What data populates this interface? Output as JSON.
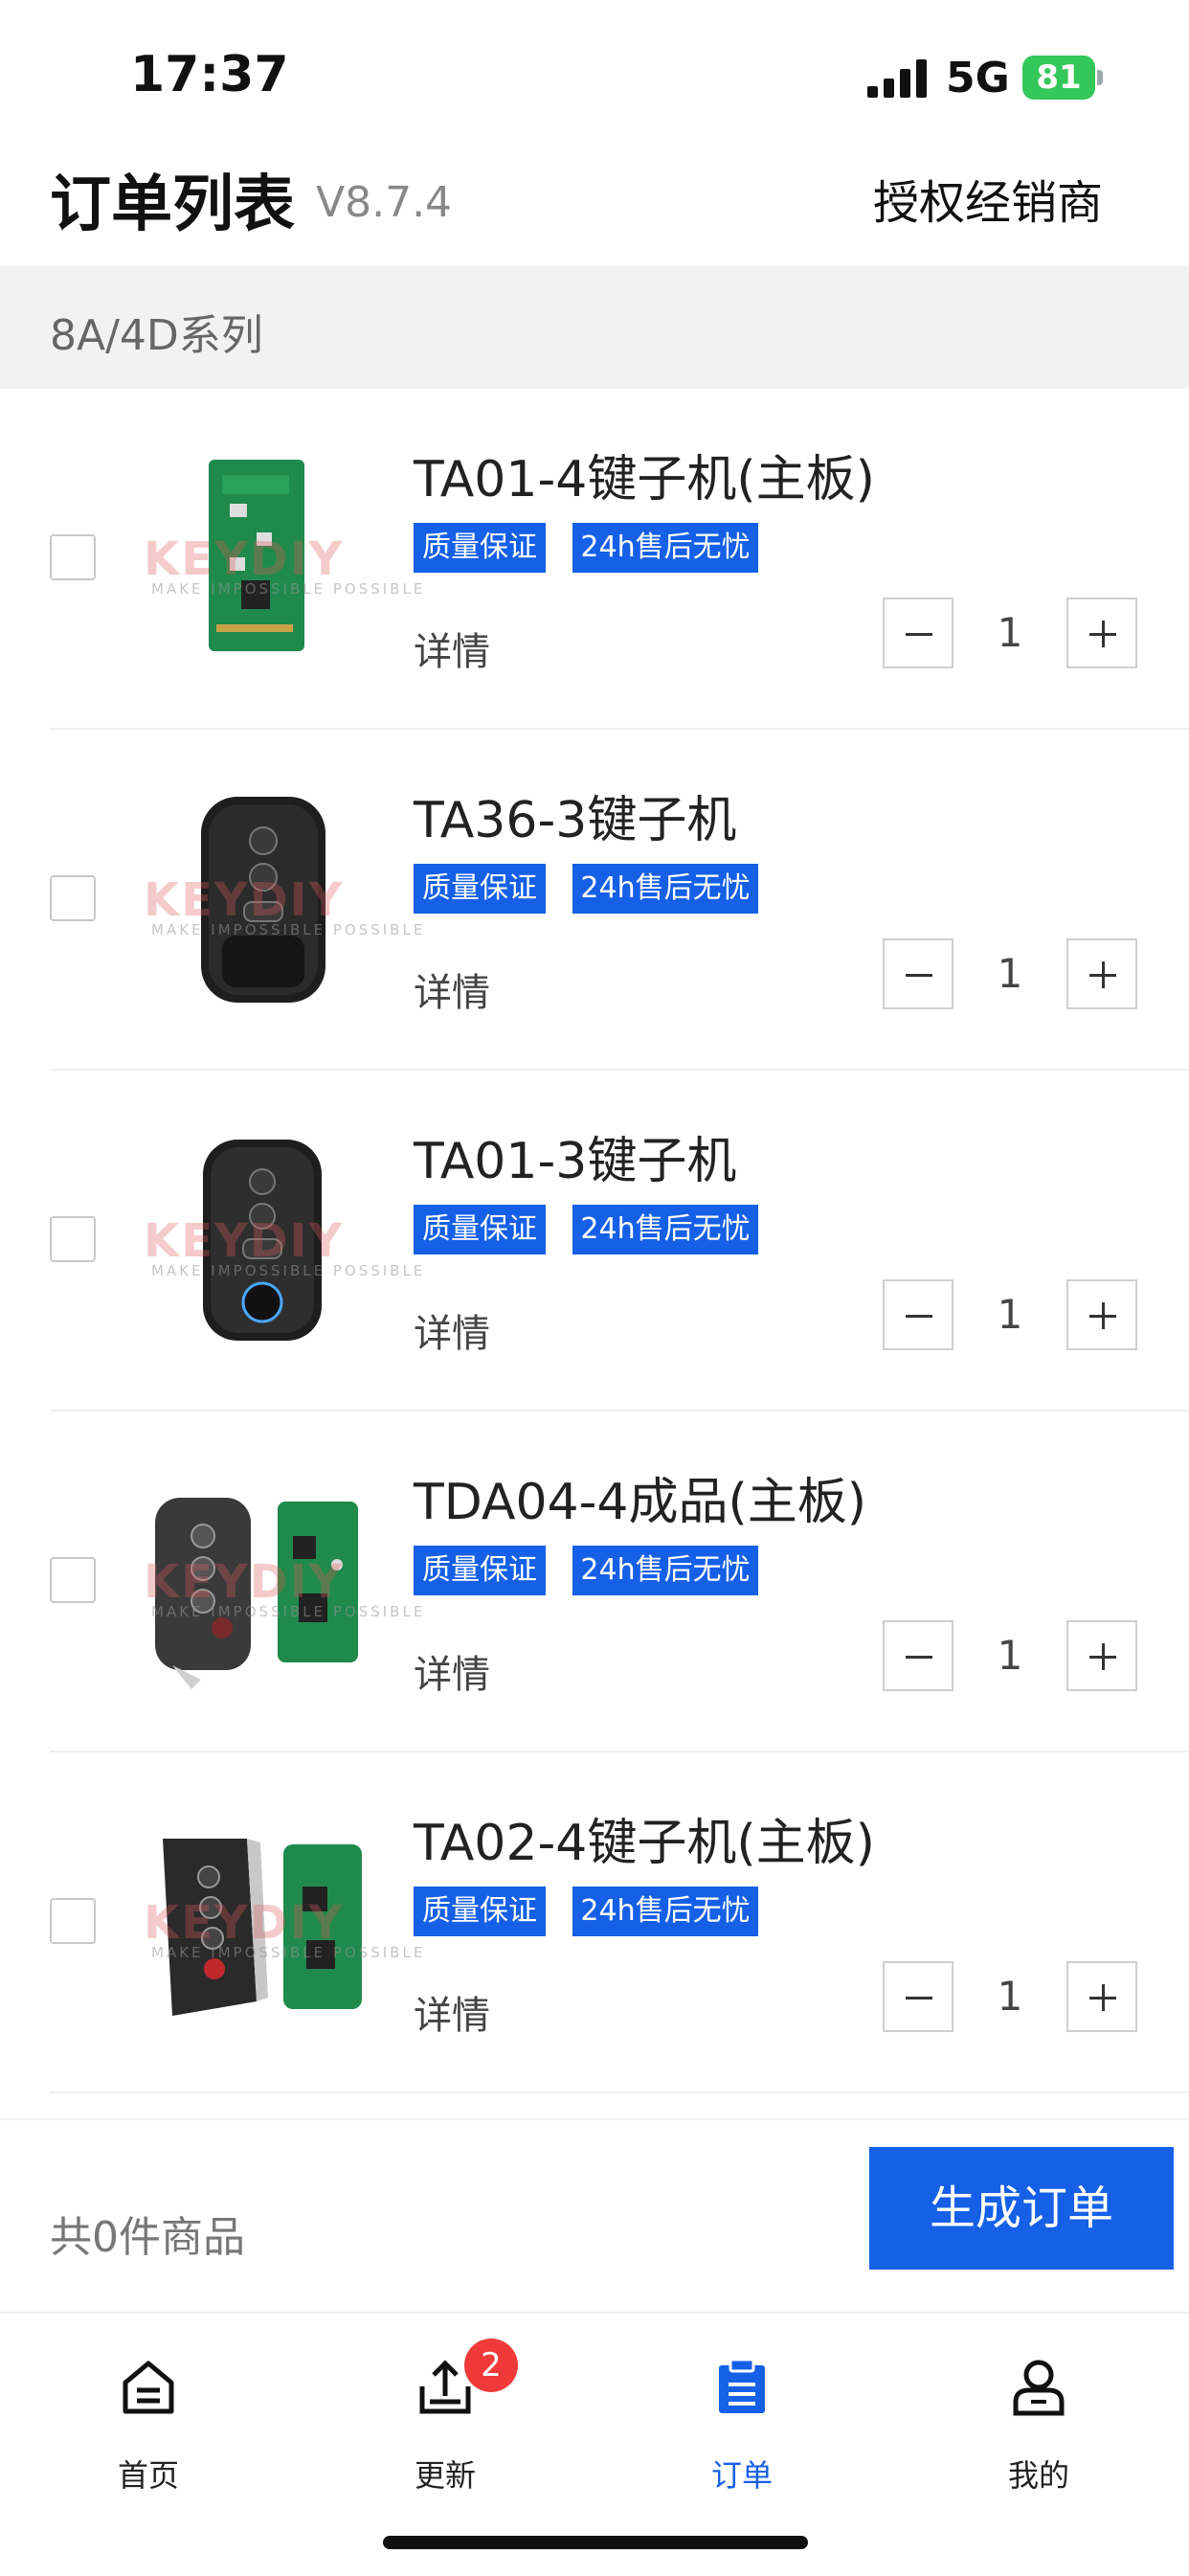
{
  "status_bar": {
    "time": "17:37",
    "network": "5G",
    "battery": "81"
  },
  "header": {
    "title": "订单列表",
    "version": "V8.7.4",
    "dealer": "授权经销商"
  },
  "section": {
    "title": "8A/4D系列"
  },
  "common": {
    "tag_quality": "质量保证",
    "tag_service": "24h售后无忧",
    "details": "详情",
    "watermark": "KEYDIY",
    "watermark_sub": "MAKE IMPOSSIBLE POSSIBLE"
  },
  "products": [
    {
      "name": "TA01-4键子机(主板)",
      "quantity": "1",
      "image": "green-pcb-board"
    },
    {
      "name": "TA36-3键子机",
      "quantity": "1",
      "image": "black-smart-key-3-button"
    },
    {
      "name": "TA01-3键子机",
      "quantity": "1",
      "image": "black-smart-key-3-button-logo"
    },
    {
      "name": "TDA04-4成品(主板)",
      "quantity": "1",
      "image": "grey-key-and-pcb"
    },
    {
      "name": "TA02-4键子机(主板)",
      "quantity": "1",
      "image": "black-silver-key-and-pcb"
    }
  ],
  "footer": {
    "item_count": "共0件商品",
    "create_order": "生成订单"
  },
  "tabs": [
    {
      "label": "首页",
      "icon": "home-icon"
    },
    {
      "label": "更新",
      "icon": "upload-icon",
      "badge": "2"
    },
    {
      "label": "订单",
      "icon": "order-clipboard-icon",
      "active": true
    },
    {
      "label": "我的",
      "icon": "user-icon"
    }
  ],
  "colors": {
    "accent": "#1560e6",
    "badge": "#f03a3a",
    "battery": "#34c759"
  }
}
